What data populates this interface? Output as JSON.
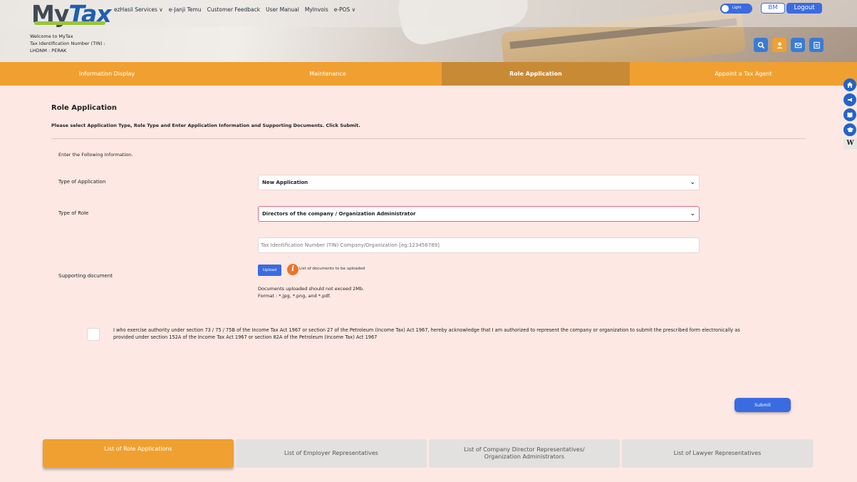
{
  "header": {
    "logo_main": "My",
    "logo_accent": "Tax",
    "nav": [
      "ezHasil Services ∨",
      "e-Janji Temu",
      "Customer Feedback",
      "User Manual",
      "MyInvois",
      "e-POS ∨"
    ],
    "theme_toggle_label": "Light",
    "lang_button": "BM",
    "logout_button": "Logout",
    "welcome": "Welcome to MyTax",
    "tin_label": "Tax Identification Number (TIN) :",
    "branch": "LHDNM : PERAK",
    "quick_icons": [
      "search-icon",
      "profile-icon",
      "mail-icon",
      "logout-door-icon"
    ]
  },
  "main_tabs": [
    {
      "label": "Information Display",
      "active": false
    },
    {
      "label": "Maintenance",
      "active": false
    },
    {
      "label": "Role Application",
      "active": true
    },
    {
      "label": "Appoint a Tax Agent",
      "active": false
    }
  ],
  "side_icons": [
    "home-icon",
    "announcement-icon",
    "book-icon",
    "graduation-cap-icon",
    "wikipedia-icon"
  ],
  "form": {
    "title": "Role Application",
    "instruction": "Please select Application Type, Role Type and Enter Application Information and Supporting Documents. Click Submit.",
    "enter_info": "Enter the Following Information.",
    "type_of_application_label": "Type of Application",
    "type_of_application_value": "New Application",
    "type_of_role_label": "Type of Role",
    "type_of_role_value": "Directors of the company / Organization Administrator",
    "tin_placeholder": "Tax Identification Number (TIN) Company/Organization [eg:123456789]",
    "supporting_document_label": "Supporting document",
    "upload_button": "Upload",
    "doc_list_link": "List of documents to be uploaded",
    "doc_note_1": "Documents uploaded should not exceed 2Mb.",
    "doc_note_2": "Format : *.jpg, *.png, and *.pdf.",
    "acknowledgement": "I who exercise authority under section 73 / 75 / 75B of the Income Tax Act 1967 or section 27 of the Petroleum (Income Tax) Act 1967, hereby acknowledge that I am authorized to represent the company or organization to submit the prescribed form electronically as provided under section 152A of the Income Tax Act 1967 or section 82A of the Petroleum (Income Tax) Act 1967",
    "submit_button": "Submit"
  },
  "bottom_tabs": [
    {
      "label": "List of Role Applications",
      "active": true
    },
    {
      "label": "List of Employer Representatives",
      "active": false
    },
    {
      "label": "List of Company Director Representatives/ Organization Administrators",
      "active": false
    },
    {
      "label": "List of Lawyer Representatives",
      "active": false
    }
  ],
  "colors": {
    "accent_orange": "#f0a030",
    "active_tab": "#c98a35",
    "primary_blue": "#3a6be0",
    "page_bg": "#fde8e3"
  }
}
